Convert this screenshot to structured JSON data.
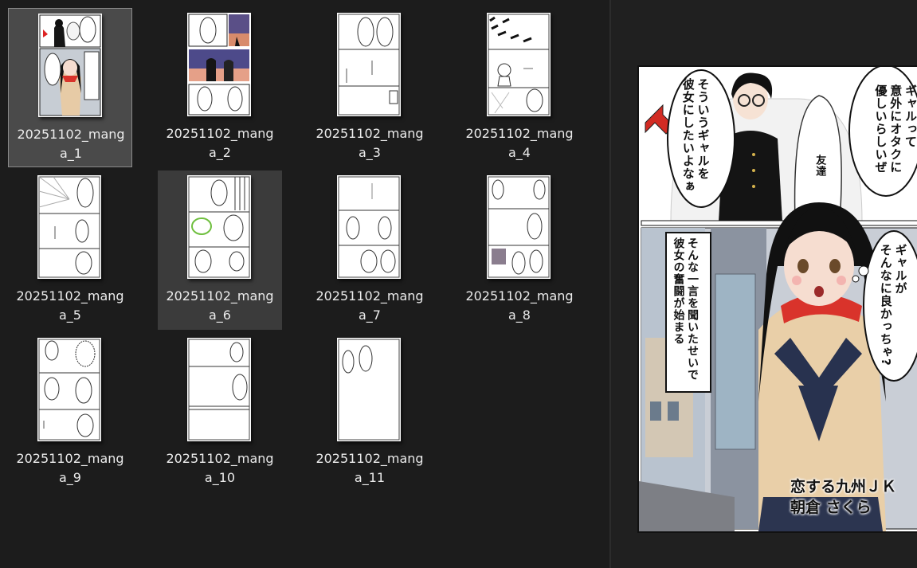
{
  "files": [
    {
      "label": "20251102_manga_1",
      "state": "selected"
    },
    {
      "label": "20251102_manga_2",
      "state": "normal"
    },
    {
      "label": "20251102_manga_3",
      "state": "normal"
    },
    {
      "label": "20251102_manga_4",
      "state": "normal"
    },
    {
      "label": "20251102_manga_5",
      "state": "normal"
    },
    {
      "label": "20251102_manga_6",
      "state": "hover"
    },
    {
      "label": "20251102_manga_7",
      "state": "normal"
    },
    {
      "label": "20251102_manga_8",
      "state": "normal"
    },
    {
      "label": "20251102_manga_9",
      "state": "normal"
    },
    {
      "label": "20251102_manga_10",
      "state": "normal"
    },
    {
      "label": "20251102_manga_11",
      "state": "normal"
    }
  ],
  "preview": {
    "bubble1": "ギャルって\n意外にオタクに\n優しいらしいぜ",
    "bubble2": "そういうギャルを\n彼女にしたいよなぁ",
    "friend_label": "友達",
    "bubble3": "ギャルが\nそんなに良かっちゃ?",
    "narration": "そんな一言を聞いたせいで\n彼女の奮闘が始まる",
    "caption_line1": "恋する九州ＪＫ",
    "caption_line2": "朝倉 さくら"
  },
  "colors": {
    "background": "#1c1c1c",
    "selected_tile": "#4a4a4a",
    "hover_tile": "#3b3b3b",
    "preview_background": "#202020",
    "scarf_red": "#d9332b",
    "cardigan": "#e9cfa8",
    "uniform_navy": "#28324f"
  }
}
